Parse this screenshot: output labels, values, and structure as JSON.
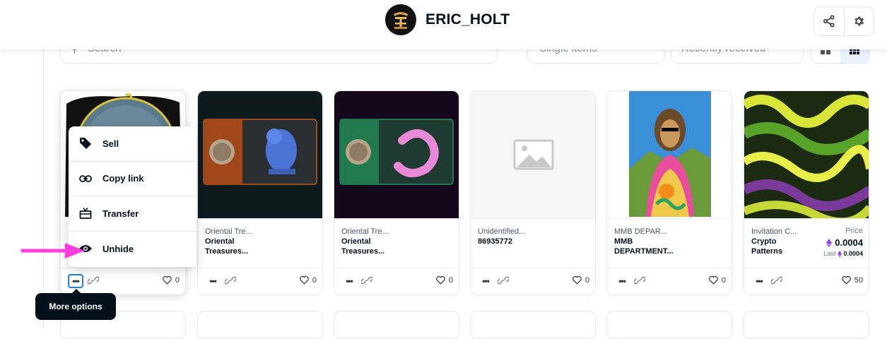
{
  "header": {
    "username": "ERIC_HOLT"
  },
  "filters": {
    "search_placeholder": "Search",
    "type_value": "Single items",
    "sort_value": "Recently received"
  },
  "context_menu": {
    "items": [
      {
        "label": "Sell"
      },
      {
        "label": "Copy link"
      },
      {
        "label": "Transfer"
      },
      {
        "label": "Unhide"
      }
    ]
  },
  "tooltip": "More options",
  "cards": [
    {
      "collection": "",
      "name": "",
      "likes": "0"
    },
    {
      "collection": "Oriental Tre...",
      "name": "Oriental Treasures...",
      "likes": "0"
    },
    {
      "collection": "Oriental Tre...",
      "name": "Oriental Treasures...",
      "likes": "0"
    },
    {
      "collection": "Unidentified...",
      "name": "86935772",
      "likes": "0"
    },
    {
      "collection": "MMB DEPAR...",
      "name": "MMB DEPARTMENT...",
      "likes": "0"
    },
    {
      "collection": "Invitation C...",
      "name": "Crypto Patterns",
      "likes": "50",
      "price_label": "Price",
      "price": "0.0004",
      "last_label": "Last",
      "last_price": "0.0004"
    }
  ],
  "colors": {
    "accent": "#2081e2",
    "annotation_arrow": "#ff3ddc",
    "eth": "#8a3ffc"
  }
}
